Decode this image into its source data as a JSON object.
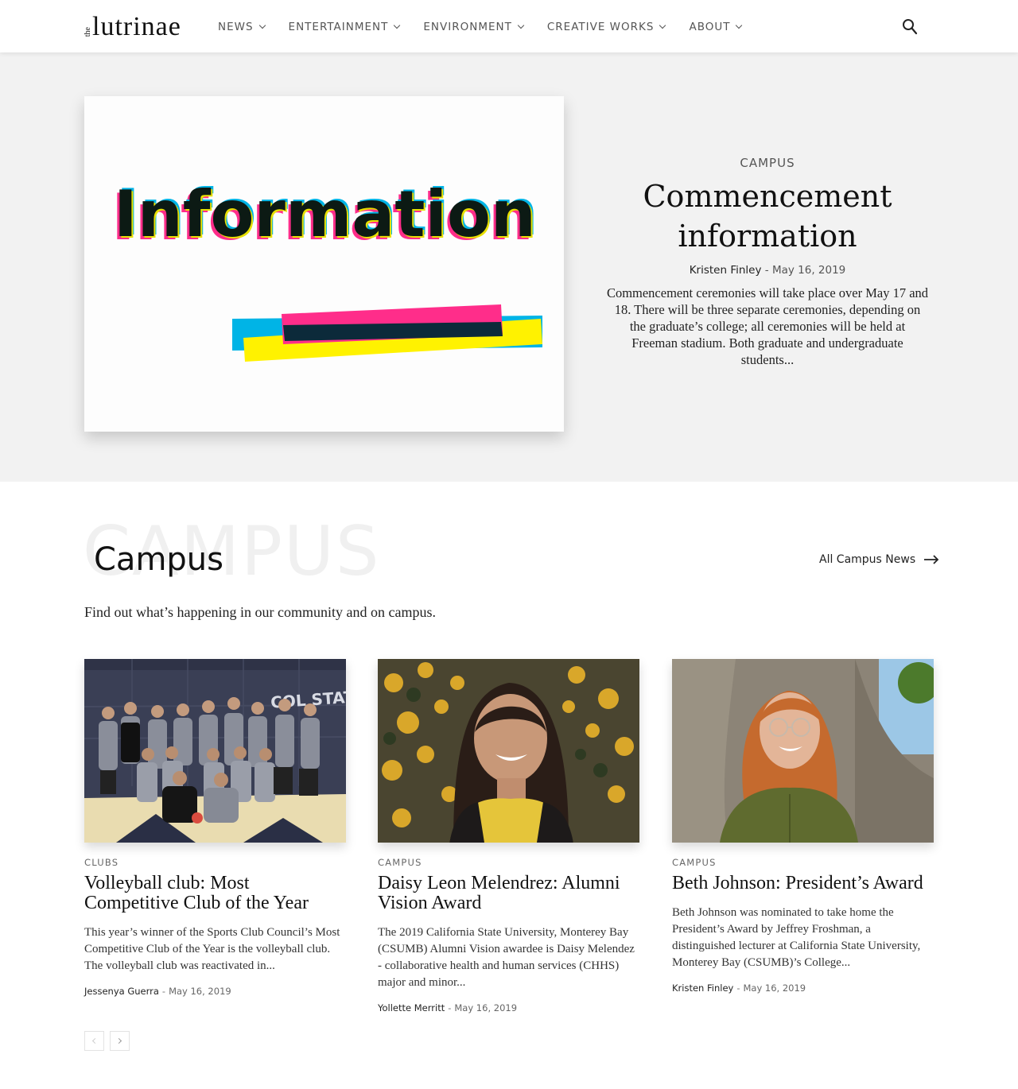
{
  "header": {
    "logo_small": "the",
    "logo_main": "lutrinae",
    "nav": [
      {
        "label": "NEWS"
      },
      {
        "label": "ENTERTAINMENT"
      },
      {
        "label": "ENVIRONMENT"
      },
      {
        "label": "CREATIVE WORKS"
      },
      {
        "label": "ABOUT"
      }
    ]
  },
  "hero": {
    "image_word": "Information",
    "category": "CAMPUS",
    "title": "Commencement information",
    "author": "Kristen Finley",
    "date": "May 16, 2019",
    "excerpt": "Commencement ceremonies will take place over May 17 and 18. There will be three separate ceremonies, depending on the graduate’s college; all ceremonies will be held at Freeman stadium. Both graduate and undergraduate students..."
  },
  "section": {
    "bg_word": "CAMPUS",
    "title": "Campus",
    "all_link": "All Campus News",
    "subtitle": "Find out what’s happening in our community and on campus."
  },
  "cards": [
    {
      "category": "CLUBS",
      "title": "Volleyball club: Most Competitive Club of the Year",
      "excerpt": "This year’s winner of the Sports Club Council’s Most Competitive Club of the Year is the volleyball club. The volleyball club was reactivated in...",
      "author": "Jessenya Guerra",
      "date": "May 16, 2019"
    },
    {
      "category": "CAMPUS",
      "title": "Daisy Leon Melendrez: Alumni Vision Award",
      "excerpt": "The 2019 California State University, Monterey Bay (CSUMB) Alumni Vision awardee is Daisy Melendez - collaborative health and human services (CHHS) major and minor...",
      "author": "Yollette Merritt",
      "date": "May 16, 2019"
    },
    {
      "category": "CAMPUS",
      "title": "Beth Johnson: President’s Award",
      "excerpt": "Beth Johnson was nominated to take home the President’s Award by Jeffrey Froshman, a distinguished lecturer at California State University, Monterey Bay (CSUMB)’s College...",
      "author": "Kristen Finley",
      "date": "May 16, 2019"
    }
  ],
  "icons": {
    "search": "search-icon",
    "arrow": "arrow-right-icon",
    "prev": "chevron-left-icon",
    "next": "chevron-right-icon"
  },
  "colors": {
    "hero_bg": "#f2f2f2",
    "magenta": "#ff2d8a",
    "cyan": "#00b4e6",
    "yellow": "#fff200"
  }
}
